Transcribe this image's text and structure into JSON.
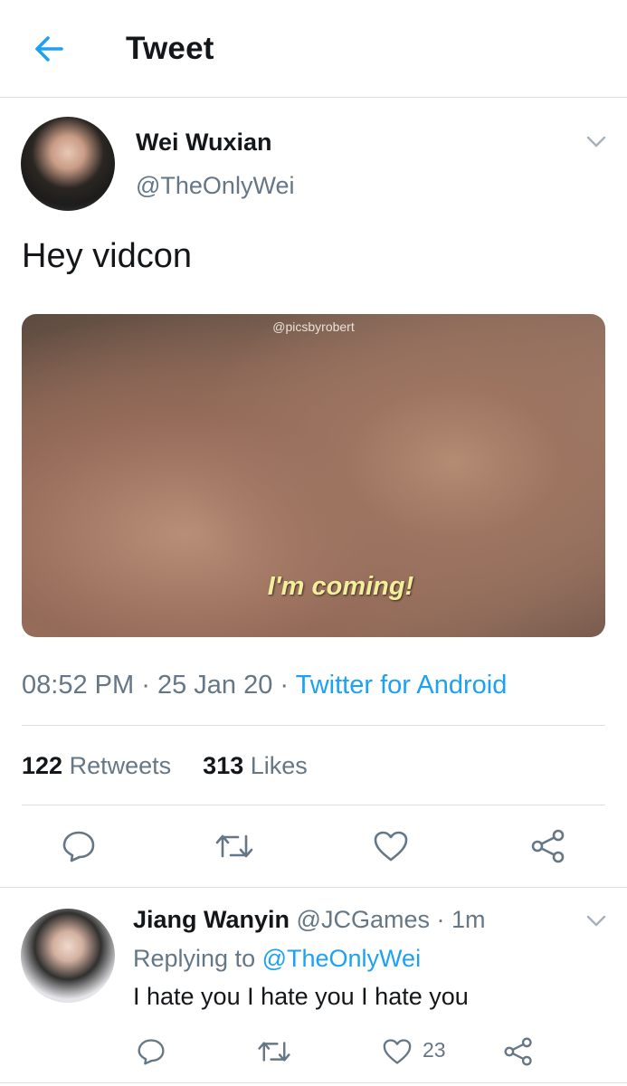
{
  "header": {
    "title": "Tweet",
    "back_icon": "arrow-left-icon"
  },
  "colors": {
    "accent": "#1da1f2",
    "text_primary": "#14171a",
    "text_secondary": "#657786",
    "divider": "#d9dee2",
    "caption_yellow": "#f2ee9c"
  },
  "tweet": {
    "author_name": "Wei Wuxian",
    "author_handle": "@TheOnlyWei",
    "text": "Hey vidcon",
    "media": {
      "watermark": "@picsbyrobert",
      "caption": "I'm coming!"
    },
    "time": "08:52 PM",
    "date": "25 Jan 20",
    "separator": "·",
    "source": "Twitter for Android",
    "retweets_count": "122",
    "retweets_label": "Retweets",
    "likes_count": "313",
    "likes_label": "Likes",
    "actions": [
      "reply-icon",
      "retweet-icon",
      "like-icon",
      "share-icon"
    ]
  },
  "reply": {
    "author_name": "Jiang Wanyin",
    "author_handle": "@JCGames",
    "separator": "·",
    "time_ago": "1m",
    "replying_prefix": "Replying to",
    "replying_to": "@TheOnlyWei",
    "text": "I hate you I hate you I hate you",
    "like_count": "23",
    "actions": [
      "reply-icon",
      "retweet-icon",
      "like-icon",
      "share-icon"
    ]
  }
}
